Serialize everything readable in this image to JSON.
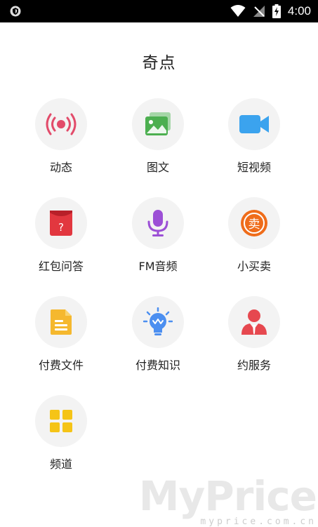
{
  "status_bar": {
    "time": "4:00"
  },
  "page": {
    "title": "奇点"
  },
  "menu": [
    {
      "label": "动态",
      "icon": "live-broadcast-icon"
    },
    {
      "label": "图文",
      "icon": "image-text-icon"
    },
    {
      "label": "短视频",
      "icon": "video-camera-icon"
    },
    {
      "label": "红包问答",
      "icon": "red-envelope-icon"
    },
    {
      "label": "FM音频",
      "icon": "microphone-icon"
    },
    {
      "label": "小买卖",
      "icon": "sell-badge-icon",
      "badge": "卖"
    },
    {
      "label": "付费文件",
      "icon": "document-icon"
    },
    {
      "label": "付费知识",
      "icon": "lightbulb-icon"
    },
    {
      "label": "约服务",
      "icon": "person-service-icon"
    },
    {
      "label": "频道",
      "icon": "channel-grid-icon"
    }
  ],
  "watermark": {
    "brand": "MyPrice",
    "url": "myprice.com.cn"
  },
  "colors": {
    "live": "#e24b6a",
    "image": "#4caf50",
    "video": "#3ba3ee",
    "red": "#e2373f",
    "mic": "#9c4fd6",
    "sell": "#ef6c1a",
    "doc": "#f5b82e",
    "bulb": "#4c8ff0",
    "service": "#e6484f",
    "channel": "#f5c417"
  }
}
